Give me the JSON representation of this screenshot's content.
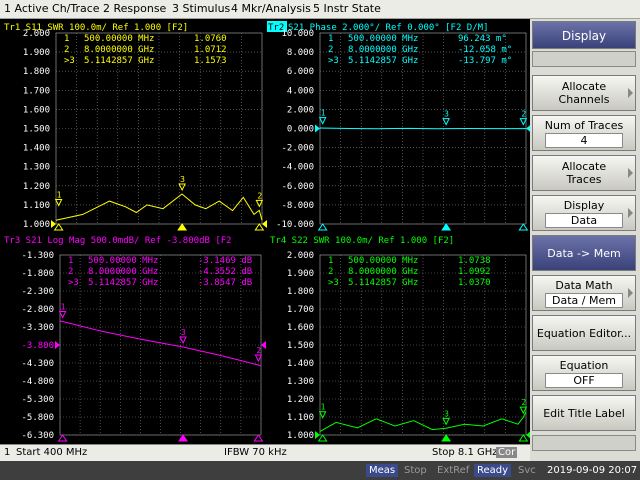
{
  "menubar": [
    "1 Active Ch/Trace",
    "2 Response",
    "3 Stimulus",
    "4 Mkr/Analysis",
    "5 Instr State"
  ],
  "colors": {
    "tr1": "#ffff00",
    "tr2": "#00ffff",
    "tr3": "#ff00ff",
    "tr4": "#00ff00",
    "grid": "#808080",
    "label": "#ffffff"
  },
  "traces": [
    {
      "header": "Tr1  S11  SWR 100.0m/ Ref 1.000 [F2]",
      "active": false,
      "yticks": [
        "2.000",
        "1.900",
        "1.800",
        "1.700",
        "1.600",
        "1.500",
        "1.400",
        "1.300",
        "1.200",
        "1.100",
        "1.000"
      ],
      "ylim": [
        1.0,
        2.0
      ],
      "markers": [
        {
          "n": "1",
          "freq": "500.00000 MHz",
          "val": "1.0760"
        },
        {
          "n": "2",
          "freq": "8.0000000 GHz",
          "val": "1.0712"
        },
        {
          "n": ">3",
          "freq": "5.1142857 GHz",
          "val": "1.1573"
        }
      ],
      "x_ghz": [
        0.4,
        1.4,
        2.4,
        3.0,
        3.4,
        3.8,
        4.4,
        5.11,
        5.6,
        6.0,
        6.5,
        7.0,
        7.4,
        7.8,
        8.0,
        8.1
      ],
      "y": [
        1.02,
        1.05,
        1.12,
        1.09,
        1.06,
        1.1,
        1.08,
        1.157,
        1.1,
        1.08,
        1.12,
        1.07,
        1.14,
        1.05,
        1.071,
        1.02
      ]
    },
    {
      "header": "Tr2  S21  Phase 2.000°/ Ref 0.000° [F2 D/M]",
      "active": true,
      "active_tag": "Tr2",
      "yticks": [
        "10.000",
        "8.000",
        "6.000",
        "4.000",
        "2.000",
        "0.000",
        "-2.000",
        "-4.000",
        "-6.000",
        "-8.000",
        "-10.000"
      ],
      "ylim": [
        -10,
        10
      ],
      "markers": [
        {
          "n": "1",
          "freq": "500.00000 MHz",
          "val": "96.243 m°"
        },
        {
          "n": "2",
          "freq": "8.0000000 GHz",
          "val": "-12.058 m°"
        },
        {
          "n": ">3",
          "freq": "5.1142857 GHz",
          "val": "-13.797 m°"
        }
      ],
      "x_ghz": [
        0.4,
        1.5,
        2.6,
        3.7,
        4.8,
        5.11,
        6.0,
        7.0,
        8.0,
        8.1
      ],
      "y": [
        0.05,
        0.0,
        -0.02,
        0.01,
        -0.03,
        -0.014,
        0.0,
        -0.01,
        -0.012,
        0.0
      ]
    },
    {
      "header": "Tr3  S21  Log Mag 500.0mdB/ Ref -3.800dB [F2",
      "yticks": [
        "-1.300",
        "-1.800",
        "-2.300",
        "-2.800",
        "-3.300",
        "-3.800",
        "-4.300",
        "-4.800",
        "-5.300",
        "-5.800",
        "-6.300"
      ],
      "ref_label": "-3.800",
      "ylim": [
        -6.3,
        -1.3
      ],
      "markers": [
        {
          "n": "1",
          "freq": "500.00000 MHz",
          "val": "-3.1469 dB"
        },
        {
          "n": "2",
          "freq": "8.0000000 GHz",
          "val": "-4.3552 dB"
        },
        {
          "n": ">3",
          "freq": "5.1142857 GHz",
          "val": "-3.8547 dB"
        }
      ],
      "x_ghz": [
        0.4,
        0.5,
        2.0,
        3.5,
        5.11,
        6.5,
        8.0,
        8.1
      ],
      "y": [
        -3.13,
        -3.147,
        -3.42,
        -3.64,
        -3.855,
        -4.08,
        -4.355,
        -4.38
      ]
    },
    {
      "header": "Tr4  S22  SWR 100.0m/ Ref 1.000 [F2]",
      "yticks": [
        "2.000",
        "1.900",
        "1.800",
        "1.700",
        "1.600",
        "1.500",
        "1.400",
        "1.300",
        "1.200",
        "1.100",
        "1.000"
      ],
      "ylim": [
        1.0,
        2.0
      ],
      "markers": [
        {
          "n": "1",
          "freq": "500.00000 MHz",
          "val": "1.0738"
        },
        {
          "n": "2",
          "freq": "8.0000000 GHz",
          "val": "1.0992"
        },
        {
          "n": ">3",
          "freq": "5.1142857 GHz",
          "val": "1.0370"
        }
      ],
      "x_ghz": [
        0.4,
        1.0,
        1.8,
        2.5,
        3.2,
        3.9,
        4.6,
        5.11,
        5.8,
        6.5,
        7.2,
        7.8,
        8.0,
        8.1
      ],
      "y": [
        1.02,
        1.07,
        1.04,
        1.09,
        1.05,
        1.08,
        1.03,
        1.037,
        1.06,
        1.05,
        1.09,
        1.06,
        1.099,
        1.13
      ]
    }
  ],
  "status": {
    "channel": "1",
    "start": "Start 400 MHz",
    "ifbw": "IFBW 70 kHz",
    "stop": "Stop 8.1 GHz",
    "cor": "Cor"
  },
  "instr": {
    "meas": "Meas",
    "stop": "Stop",
    "extref": "ExtRef",
    "ready": "Ready",
    "svc": "Svc",
    "datetime": "2019-09-09 20:07"
  },
  "softkeys": {
    "title": "Display",
    "allocate_channels": [
      "Allocate",
      "Channels"
    ],
    "num_traces": {
      "label": "Num of Traces",
      "value": "4"
    },
    "allocate_traces": [
      "Allocate",
      "Traces"
    ],
    "display": {
      "label": "Display",
      "value": "Data"
    },
    "data_mem": "Data -> Mem",
    "data_math": {
      "label": "Data Math",
      "value": "Data / Mem"
    },
    "equation_editor": "Equation Editor...",
    "equation": {
      "label": "Equation",
      "value": "OFF"
    },
    "edit_title": "Edit Title Label"
  }
}
